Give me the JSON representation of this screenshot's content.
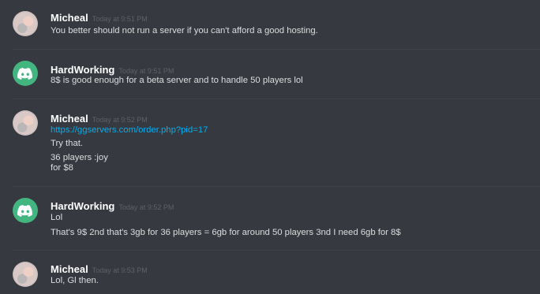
{
  "messages": [
    {
      "username": "Micheal",
      "timestamp": "Today at 9:51 PM",
      "avatar": "user-photo",
      "lines": [
        "You better should not run a server if you can't afford a good hosting."
      ]
    },
    {
      "username": "HardWorking",
      "timestamp": "Today at 9:51 PM",
      "avatar": "discord-default-icon",
      "lines": [
        "8$ is good enough for a beta server and to handle 50 players lol"
      ]
    },
    {
      "username": "Micheal",
      "timestamp": "Today at 9:52 PM",
      "avatar": "user-photo",
      "link": "https://ggservers.com/order.php?pid=17",
      "lines": [
        "Try that.",
        "36 players :joy",
        "for $8"
      ]
    },
    {
      "username": "HardWorking",
      "timestamp": "Today at 9:52 PM",
      "avatar": "discord-default-icon",
      "lines": [
        "Lol",
        "That's 9$ 2nd that's 3gb for 36 players = 6gb for around 50 players 3nd I need 6gb for 8$"
      ]
    },
    {
      "username": "Micheal",
      "timestamp": "Today at 9:53 PM",
      "avatar": "user-photo",
      "lines": [
        "Lol, Gl then."
      ]
    }
  ],
  "colors": {
    "background": "#36393f",
    "username": "#ffffff",
    "timestamp": "#5e6166",
    "text": "#dcddde",
    "link": "#00b0f4",
    "discord_avatar": "#43b581"
  }
}
